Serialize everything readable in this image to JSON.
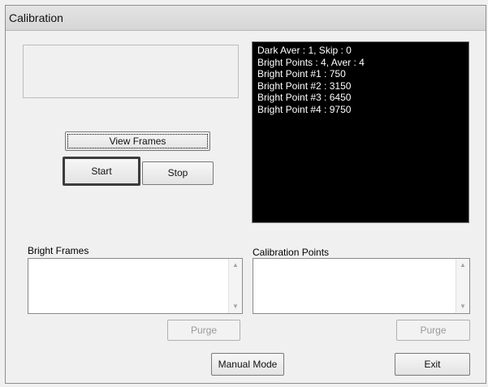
{
  "window": {
    "title": "Calibration"
  },
  "log": {
    "lines": [
      "Dark Aver : 1, Skip : 0",
      "Bright Points : 4, Aver : 4",
      "Bright Point #1 : 750",
      "Bright Point #2 : 3150",
      "Bright Point #3 : 6450",
      "Bright Point #4 : 9750"
    ]
  },
  "buttons": {
    "view_frames": "View Frames",
    "start": "Start",
    "stop": "Stop",
    "purge_left": "Purge",
    "purge_right": "Purge",
    "manual_mode": "Manual Mode",
    "exit": "Exit"
  },
  "lists": {
    "bright_frames": {
      "label": "Bright Frames"
    },
    "calibration_points": {
      "label": "Calibration Points"
    }
  },
  "icons": {
    "scroll_up": "scroll-up-arrow",
    "scroll_down": "scroll-down-arrow"
  }
}
